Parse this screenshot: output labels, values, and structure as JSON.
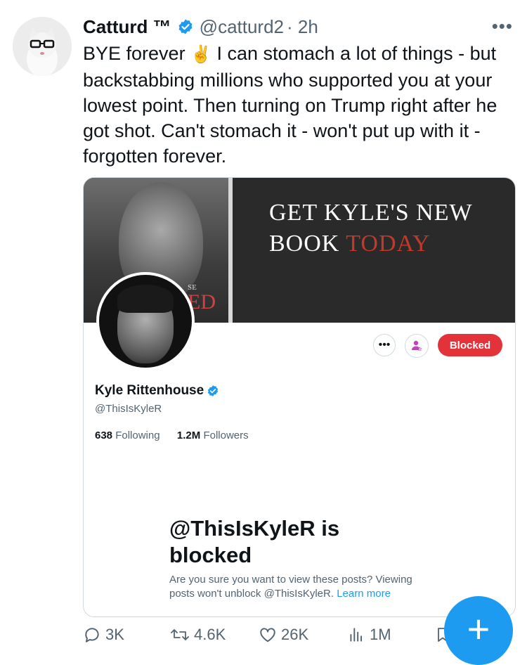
{
  "tweet": {
    "author_name": "Catturd ™",
    "author_handle": "@catturd2",
    "time": "· 2h",
    "more": "•••",
    "text_before_emoji": "BYE forever",
    "emoji": "✌️",
    "text_after_emoji": " I can stomach a lot of things - but backstabbing millions who supported you at your lowest point. Then turning on Trump right after he got shot. Can't stomach it - won't put up with it - forgotten forever."
  },
  "card": {
    "banner": {
      "book_cover_text_small": "SE",
      "book_cover_text_large": "ED",
      "title_white": "GET KYLE'S NEW BOOK",
      "title_red": "TODAY"
    },
    "profile": {
      "name": "Kyle Rittenhouse",
      "handle": "@ThisIsKyleR",
      "following_count": "638",
      "following_label": "Following",
      "followers_count": "1.2M",
      "followers_label": "Followers"
    },
    "buttons": {
      "more_label": "•••",
      "blocked_label": "Blocked"
    },
    "blocked_notice": {
      "title": "@ThisIsKyleR is blocked",
      "description": "Are you sure you want to view these posts? Viewing posts won't unblock @ThisIsKyleR.",
      "link": "Learn more"
    }
  },
  "actions": {
    "replies": "3K",
    "reposts": "4.6K",
    "likes": "26K",
    "views": "1M"
  },
  "fab": {
    "label": "+"
  },
  "colors": {
    "accent": "#1d9bf0",
    "blocked": "#e3323a",
    "secondary_text": "#536471"
  },
  "icons": [
    "verified-badge-icon",
    "reply-icon",
    "repost-icon",
    "like-icon",
    "views-icon",
    "bookmark-icon",
    "more-icon",
    "subscribe-icon"
  ]
}
